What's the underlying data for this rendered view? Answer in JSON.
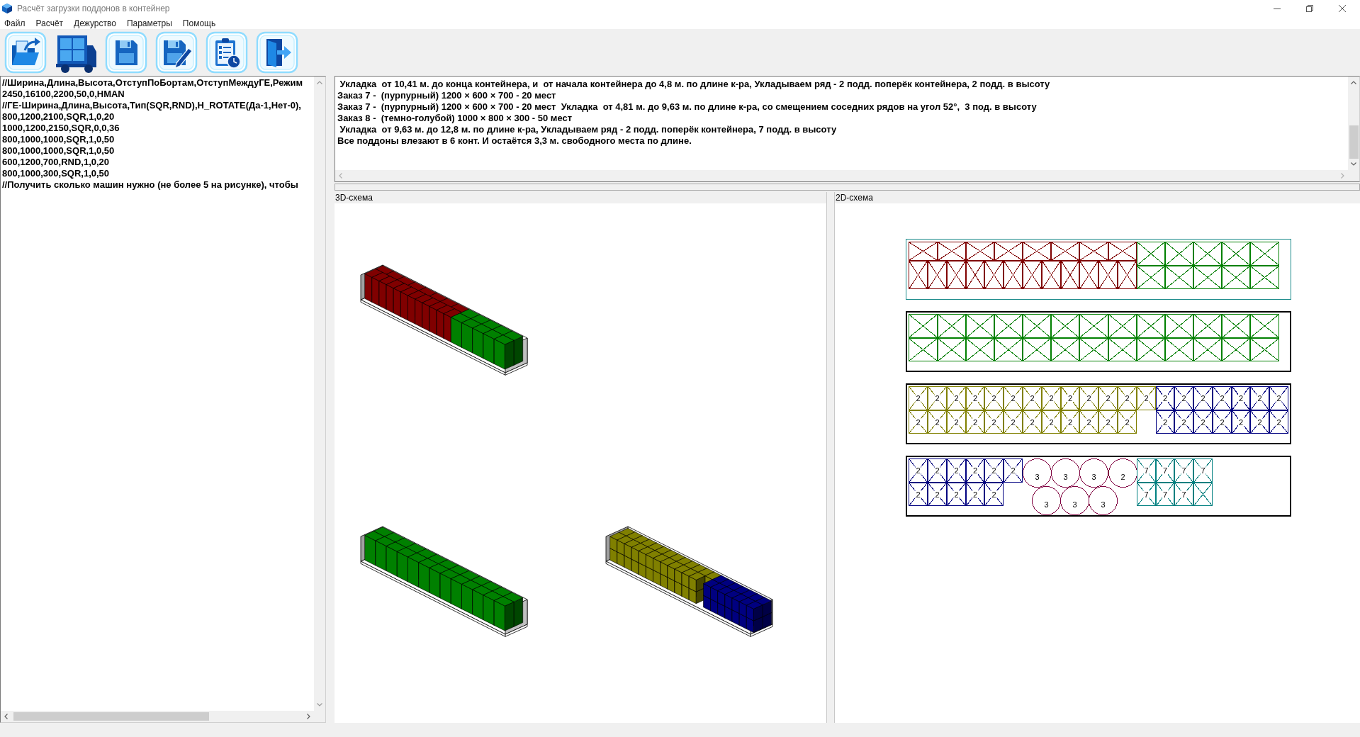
{
  "window": {
    "title": "Расчёт загрузки поддонов в контейнер"
  },
  "menu": [
    "Файл",
    "Расчёт",
    "Дежурство",
    "Параметры",
    "Помощь"
  ],
  "input_text": {
    "lines": [
      "//Ширина,Длина,Высота,ОтступПоБортам,ОтступМеждуГЕ,Режим",
      "2450,16100,2200,50,0,HMAN",
      "//ГЕ-Ширина,Длина,Высота,Тип(SQR,RND),H_ROTATE(Да-1,Нет-0),",
      "800,1200,2100,SQR,1,0,20",
      "1000,1200,2150,SQR,0,0,36",
      "800,1000,1000,SQR,1,0,50",
      "800,1000,1000,SQR,1,0,50",
      "600,1200,700,RND,1,0,20",
      "800,1000,300,SQR,1,0,50",
      "//Получить сколько машин нужно (не более 5 на рисунке), чтобы"
    ]
  },
  "log": {
    "lines": [
      " Укладка  от 10,41 м. до конца контейнера, и  от начала контейнера до 4,8 м. по длине к-ра, Укладываем ряд - 2 подд. поперёк контейнера, 2 подд. в высоту",
      "Заказ 7 -  (пурпурный) 1200 × 600 × 700 - 20 мест",
      "Заказ 7 -  (пурпурный) 1200 × 600 × 700 - 20 мест  Укладка  от 4,81 м. до 9,63 м. по длине к-ра, со смещением соседних рядов на угол 52°,  3 под. в высоту",
      "Заказ 8 -  (темно-голубой) 1000 × 800 × 300 - 50 мест",
      " Укладка  от 9,63 м. до 12,8 м. по длине к-ра, Укладываем ряд - 2 подд. поперёк контейнера, 7 подд. в высоту",
      "Все поддоны влезают в 6 конт. И остаётся 3,3 м. свободного места по длине."
    ]
  },
  "scheme_3d": {
    "title": "3D-схема",
    "views": [
      {
        "sections": [
          {
            "kind": "tall",
            "color": "#800000"
          },
          {
            "kind": "tall",
            "color": "#008000"
          }
        ]
      },
      {
        "sections": [
          {
            "kind": "tall",
            "color": "#008000"
          }
        ]
      },
      {
        "sections": [
          {
            "kind": "stacked",
            "color": "#808000"
          },
          {
            "kind": "stacked",
            "color": "#000080"
          }
        ]
      }
    ]
  },
  "scheme_2d": {
    "title": "2D-схема",
    "containers": [
      {
        "selected": true,
        "sections": [
          {
            "color": "#800000",
            "rows": [
              {
                "kind": "long",
                "cells": [
                  {
                    "kind": "plain"
                  },
                  {
                    "kind": "plain"
                  },
                  {
                    "kind": "plain"
                  },
                  {
                    "kind": "plain"
                  },
                  {
                    "kind": "plain"
                  },
                  {
                    "kind": "plain"
                  },
                  {
                    "kind": "plain"
                  },
                  {
                    "kind": "plain"
                  }
                ]
              },
              {
                "kind": "short",
                "cells": [
                  {
                    "kind": "plain"
                  },
                  {
                    "kind": "plain"
                  },
                  {
                    "kind": "plain"
                  },
                  {
                    "kind": "plain"
                  },
                  {
                    "kind": "plain"
                  },
                  {
                    "kind": "plain"
                  },
                  {
                    "kind": "plain"
                  },
                  {
                    "kind": "plain"
                  },
                  {
                    "kind": "plain"
                  },
                  {
                    "kind": "plain"
                  },
                  {
                    "kind": "plain"
                  },
                  {
                    "kind": "plain"
                  }
                ]
              }
            ]
          },
          {
            "color": "#008000",
            "rows": [
              {
                "kind": "long",
                "cells": [
                  {
                    "kind": "plain"
                  },
                  {
                    "kind": "plain"
                  },
                  {
                    "kind": "plain"
                  },
                  {
                    "kind": "plain"
                  },
                  {
                    "kind": "plain"
                  }
                ]
              },
              {
                "kind": "long",
                "cells": [
                  {
                    "kind": "plain"
                  },
                  {
                    "kind": "plain"
                  },
                  {
                    "kind": "plain"
                  },
                  {
                    "kind": "plain"
                  },
                  {
                    "kind": "plain"
                  }
                ]
              }
            ]
          }
        ]
      },
      {
        "selected": false,
        "sections": [
          {
            "color": "#008000",
            "rows": [
              {
                "kind": "long",
                "cells": [
                  {
                    "kind": "plain"
                  },
                  {
                    "kind": "plain"
                  },
                  {
                    "kind": "plain"
                  },
                  {
                    "kind": "plain"
                  },
                  {
                    "kind": "plain"
                  },
                  {
                    "kind": "plain"
                  },
                  {
                    "kind": "plain"
                  },
                  {
                    "kind": "plain"
                  },
                  {
                    "kind": "plain"
                  },
                  {
                    "kind": "plain"
                  },
                  {
                    "kind": "plain"
                  },
                  {
                    "kind": "plain"
                  },
                  {
                    "kind": "plain"
                  }
                ]
              },
              {
                "kind": "long",
                "cells": [
                  {
                    "kind": "plain"
                  },
                  {
                    "kind": "plain"
                  },
                  {
                    "kind": "plain"
                  },
                  {
                    "kind": "plain"
                  },
                  {
                    "kind": "plain"
                  },
                  {
                    "kind": "plain"
                  },
                  {
                    "kind": "plain"
                  },
                  {
                    "kind": "plain"
                  },
                  {
                    "kind": "plain"
                  },
                  {
                    "kind": "plain"
                  },
                  {
                    "kind": "plain"
                  },
                  {
                    "kind": "plain"
                  },
                  {
                    "kind": "plain"
                  }
                ]
              }
            ]
          }
        ]
      },
      {
        "selected": false,
        "sections": [
          {
            "color": "#808000",
            "rows": [
              {
                "kind": "short",
                "cells": [
                  {
                    "kind": "numbered",
                    "label": "2"
                  },
                  {
                    "kind": "numbered",
                    "label": "2"
                  },
                  {
                    "kind": "numbered",
                    "label": "2"
                  },
                  {
                    "kind": "numbered",
                    "label": "2"
                  },
                  {
                    "kind": "numbered",
                    "label": "2"
                  },
                  {
                    "kind": "numbered",
                    "label": "2"
                  },
                  {
                    "kind": "numbered",
                    "label": "2"
                  },
                  {
                    "kind": "numbered",
                    "label": "2"
                  },
                  {
                    "kind": "numbered",
                    "label": "2"
                  },
                  {
                    "kind": "numbered",
                    "label": "2"
                  },
                  {
                    "kind": "numbered",
                    "label": "2"
                  },
                  {
                    "kind": "numbered",
                    "label": "2"
                  },
                  {
                    "kind": "numbered",
                    "label": "2"
                  }
                ]
              },
              {
                "kind": "short",
                "cells": [
                  {
                    "kind": "numbered",
                    "label": "2"
                  },
                  {
                    "kind": "numbered",
                    "label": "2"
                  },
                  {
                    "kind": "numbered",
                    "label": "2"
                  },
                  {
                    "kind": "numbered",
                    "label": "2"
                  },
                  {
                    "kind": "numbered",
                    "label": "2"
                  },
                  {
                    "kind": "numbered",
                    "label": "2"
                  },
                  {
                    "kind": "numbered",
                    "label": "2"
                  },
                  {
                    "kind": "numbered",
                    "label": "2"
                  },
                  {
                    "kind": "numbered",
                    "label": "2"
                  },
                  {
                    "kind": "numbered",
                    "label": "2"
                  },
                  {
                    "kind": "numbered",
                    "label": "2"
                  },
                  {
                    "kind": "numbered",
                    "label": "2"
                  }
                ]
              }
            ]
          },
          {
            "color": "#000080",
            "rows": [
              {
                "kind": "short",
                "cells": [
                  {
                    "kind": "numbered",
                    "label": "2"
                  },
                  {
                    "kind": "numbered",
                    "label": "2"
                  },
                  {
                    "kind": "numbered",
                    "label": "2"
                  },
                  {
                    "kind": "numbered",
                    "label": "2"
                  },
                  {
                    "kind": "numbered",
                    "label": "2"
                  },
                  {
                    "kind": "numbered",
                    "label": "2"
                  },
                  {
                    "kind": "numbered",
                    "label": "2"
                  }
                ]
              },
              {
                "kind": "short",
                "cells": [
                  {
                    "kind": "numbered",
                    "label": "2"
                  },
                  {
                    "kind": "numbered",
                    "label": "2"
                  },
                  {
                    "kind": "numbered",
                    "label": "2"
                  },
                  {
                    "kind": "numbered",
                    "label": "2"
                  },
                  {
                    "kind": "numbered",
                    "label": "2"
                  },
                  {
                    "kind": "numbered",
                    "label": "2"
                  },
                  {
                    "kind": "numbered",
                    "label": "2"
                  }
                ]
              }
            ]
          }
        ]
      },
      {
        "selected": false,
        "sections": [
          {
            "color": "#000080",
            "rows": [
              {
                "kind": "short",
                "cells": [
                  {
                    "kind": "numbered",
                    "label": "2"
                  },
                  {
                    "kind": "numbered",
                    "label": "2"
                  },
                  {
                    "kind": "numbered",
                    "label": "2"
                  },
                  {
                    "kind": "numbered",
                    "label": "2"
                  },
                  {
                    "kind": "numbered",
                    "label": "2"
                  },
                  {
                    "kind": "numbered",
                    "label": "2"
                  }
                ]
              },
              {
                "kind": "short",
                "cells": [
                  {
                    "kind": "numbered",
                    "label": "2"
                  },
                  {
                    "kind": "numbered",
                    "label": "2"
                  },
                  {
                    "kind": "numbered",
                    "label": "2"
                  },
                  {
                    "kind": "numbered",
                    "label": "2"
                  },
                  {
                    "kind": "numbered",
                    "label": "2"
                  }
                ]
              }
            ]
          },
          {
            "color": "#800040",
            "rows": [
              {
                "kind": "round",
                "cells": [
                  {
                    "kind": "numbered",
                    "label": "3"
                  },
                  {
                    "kind": "numbered",
                    "label": "3"
                  },
                  {
                    "kind": "numbered",
                    "label": "3"
                  },
                  {
                    "kind": "numbered",
                    "label": "2"
                  }
                ]
              },
              {
                "kind": "staggered",
                "cells": [
                  {
                    "kind": "numbered",
                    "label": "3"
                  },
                  {
                    "kind": "numbered",
                    "label": "3"
                  },
                  {
                    "kind": "numbered",
                    "label": "3"
                  }
                ]
              }
            ]
          },
          {
            "color": "#008080",
            "rows": [
              {
                "kind": "short",
                "cells": [
                  {
                    "kind": "numbered",
                    "label": "7"
                  },
                  {
                    "kind": "numbered",
                    "label": "7"
                  },
                  {
                    "kind": "numbered",
                    "label": "7"
                  },
                  {
                    "kind": "numbered",
                    "label": "7"
                  }
                ]
              },
              {
                "kind": "short",
                "cells": [
                  {
                    "kind": "numbered",
                    "label": "7"
                  },
                  {
                    "kind": "numbered",
                    "label": "7"
                  },
                  {
                    "kind": "numbered",
                    "label": "7"
                  },
                  {
                    "kind": "plain"
                  }
                ]
              }
            ]
          }
        ]
      }
    ]
  }
}
